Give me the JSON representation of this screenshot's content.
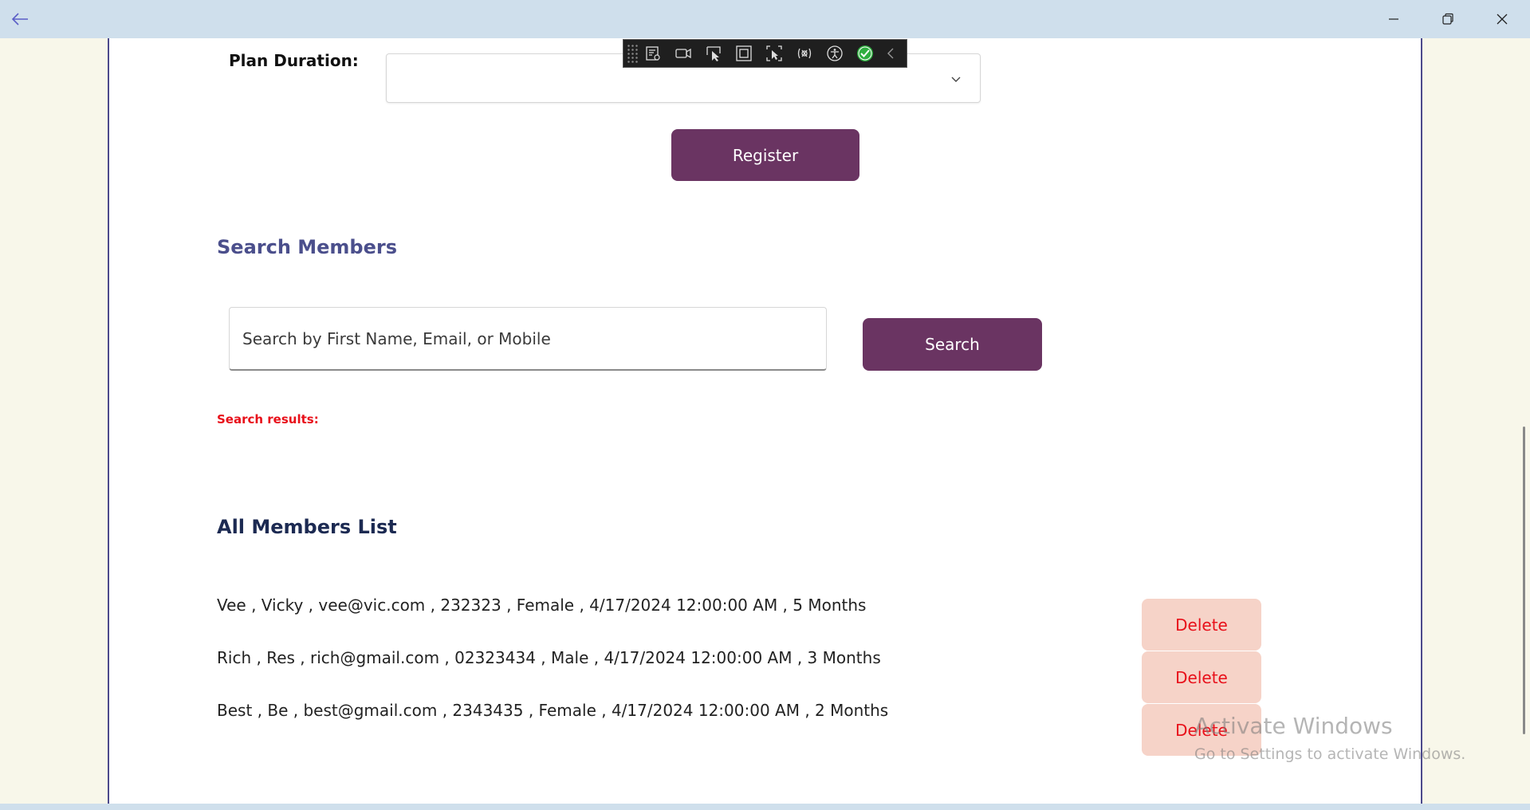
{
  "titlebar": {
    "back_icon": "arrow-left-icon",
    "minimize_icon": "minimize-icon",
    "restore_icon": "restore-icon",
    "close_icon": "close-icon"
  },
  "form": {
    "plan_duration_label": "Plan Duration:",
    "plan_duration_value": "",
    "register_label": "Register"
  },
  "debug_toolbar": {
    "icons": [
      "live-visual-tree-icon",
      "video-icon",
      "select-element-icon",
      "display-layout-adorners-icon",
      "track-focus-icon",
      "hot-reload-icon",
      "accessibility-icon",
      "checkmark-icon",
      "collapse-chevron-icon"
    ]
  },
  "search_section": {
    "title": "Search Members",
    "input_value": "",
    "input_placeholder": "Search by First Name, Email, or Mobile",
    "button_label": "Search",
    "results_label": "Search results:"
  },
  "members_section": {
    "title": "All Members List",
    "members": [
      {
        "text": "Vee , Vicky , vee@vic.com , 232323 , Female , 4/17/2024 12:00:00 AM , 5 Months",
        "delete_label": "Delete"
      },
      {
        "text": "Rich , Res , rich@gmail.com , 02323434 , Male , 4/17/2024 12:00:00 AM , 3 Months",
        "delete_label": "Delete"
      },
      {
        "text": "Best , Be , best@gmail.com , 2343435 , Female , 4/17/2024 12:00:00 AM , 2 Months",
        "delete_label": "Delete"
      }
    ]
  },
  "watermark": {
    "title": "Activate Windows",
    "subtitle": "Go to Settings to activate Windows."
  },
  "colors": {
    "accent_purple": "#6a3462",
    "delete_bg": "#f6d3c8",
    "delete_text": "#e8101a",
    "titlebar": "#cfdfec"
  }
}
